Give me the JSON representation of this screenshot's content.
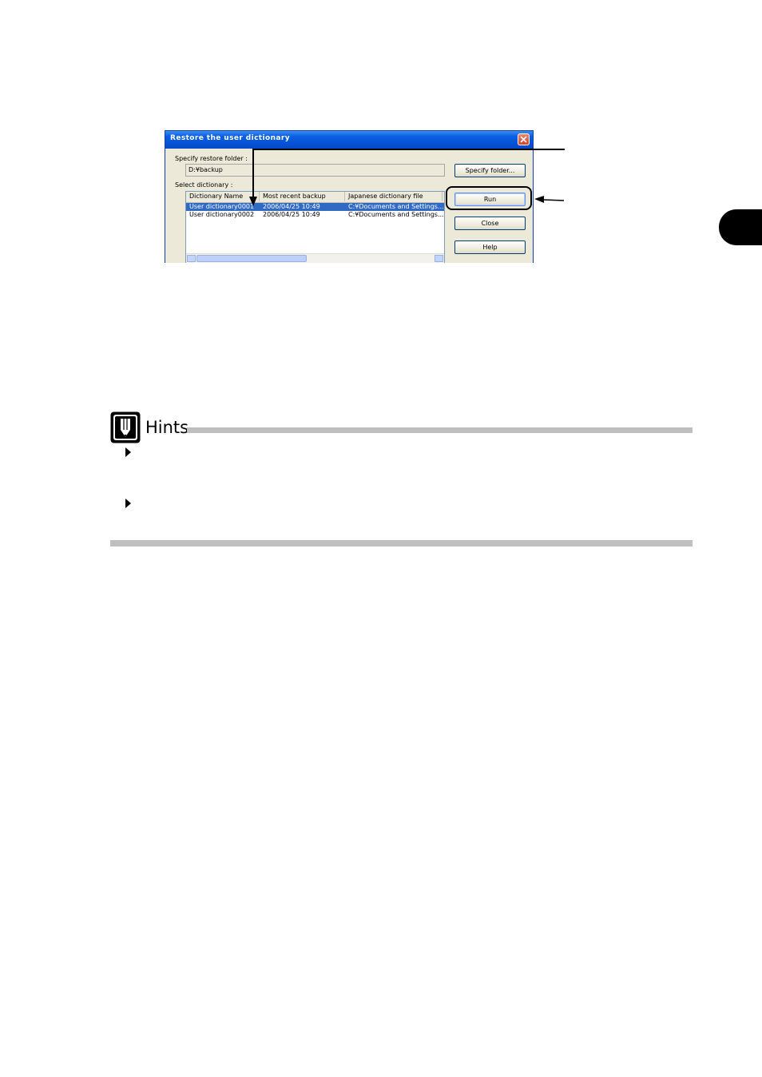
{
  "dialog": {
    "title": "Restore the user dictionary",
    "folder_label": "Specify restore folder :",
    "folder_value": "D:¥backup",
    "select_label": "Select dictionary :",
    "columns": [
      "Dictionary Name",
      "Most recent backup",
      "Japanese dictionary file"
    ],
    "rows": [
      {
        "name": "User dictionary0001",
        "backup": "2006/04/25 10:49",
        "file": "C:¥Documents and Settings...",
        "selected": true
      },
      {
        "name": "User dictionary0002",
        "backup": "2006/04/25 10:49",
        "file": "C:¥Documents and Settings..."
      }
    ],
    "buttons": {
      "specify_folder": "Specify folder...",
      "run": "Run",
      "close": "Close",
      "help": "Help"
    },
    "accent_colors": {
      "titlebar": "#0553d8",
      "selection": "#316ac5"
    }
  },
  "hints": {
    "title": "Hints"
  }
}
